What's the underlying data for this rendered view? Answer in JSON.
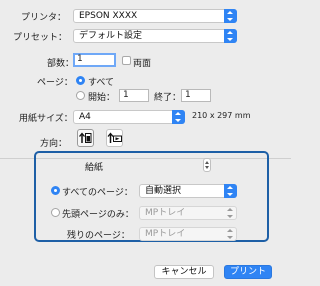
{
  "printer": {
    "label": "プリンタ：",
    "value": "EPSON XXXX"
  },
  "preset": {
    "label": "プリセット：",
    "value": "デフォルト設定"
  },
  "copies": {
    "label": "部数：",
    "value": "1",
    "duplex_label": "両面"
  },
  "pages": {
    "label": "ページ：",
    "all_label": "すべて",
    "from_label": "開始：",
    "from_value": "1",
    "to_label": "終了：",
    "to_value": "1"
  },
  "paper_size": {
    "label": "用紙サイズ：",
    "value": "A4",
    "dimensions": "210 x 297 mm"
  },
  "orientation": {
    "label": "方向："
  },
  "section_menu": {
    "value": "給紙"
  },
  "feed": {
    "all_pages_label": "すべてのページ：",
    "all_pages_value": "自動選択",
    "first_page_label": "先頭ページのみ：",
    "first_page_value": "MPトレイ",
    "remaining_label": "残りのページ：",
    "remaining_value": "MPトレイ"
  },
  "buttons": {
    "cancel": "キャンセル",
    "print": "プリント"
  },
  "colors": {
    "accent": "#2f84f4",
    "highlight_border": "#1d5fa6"
  }
}
